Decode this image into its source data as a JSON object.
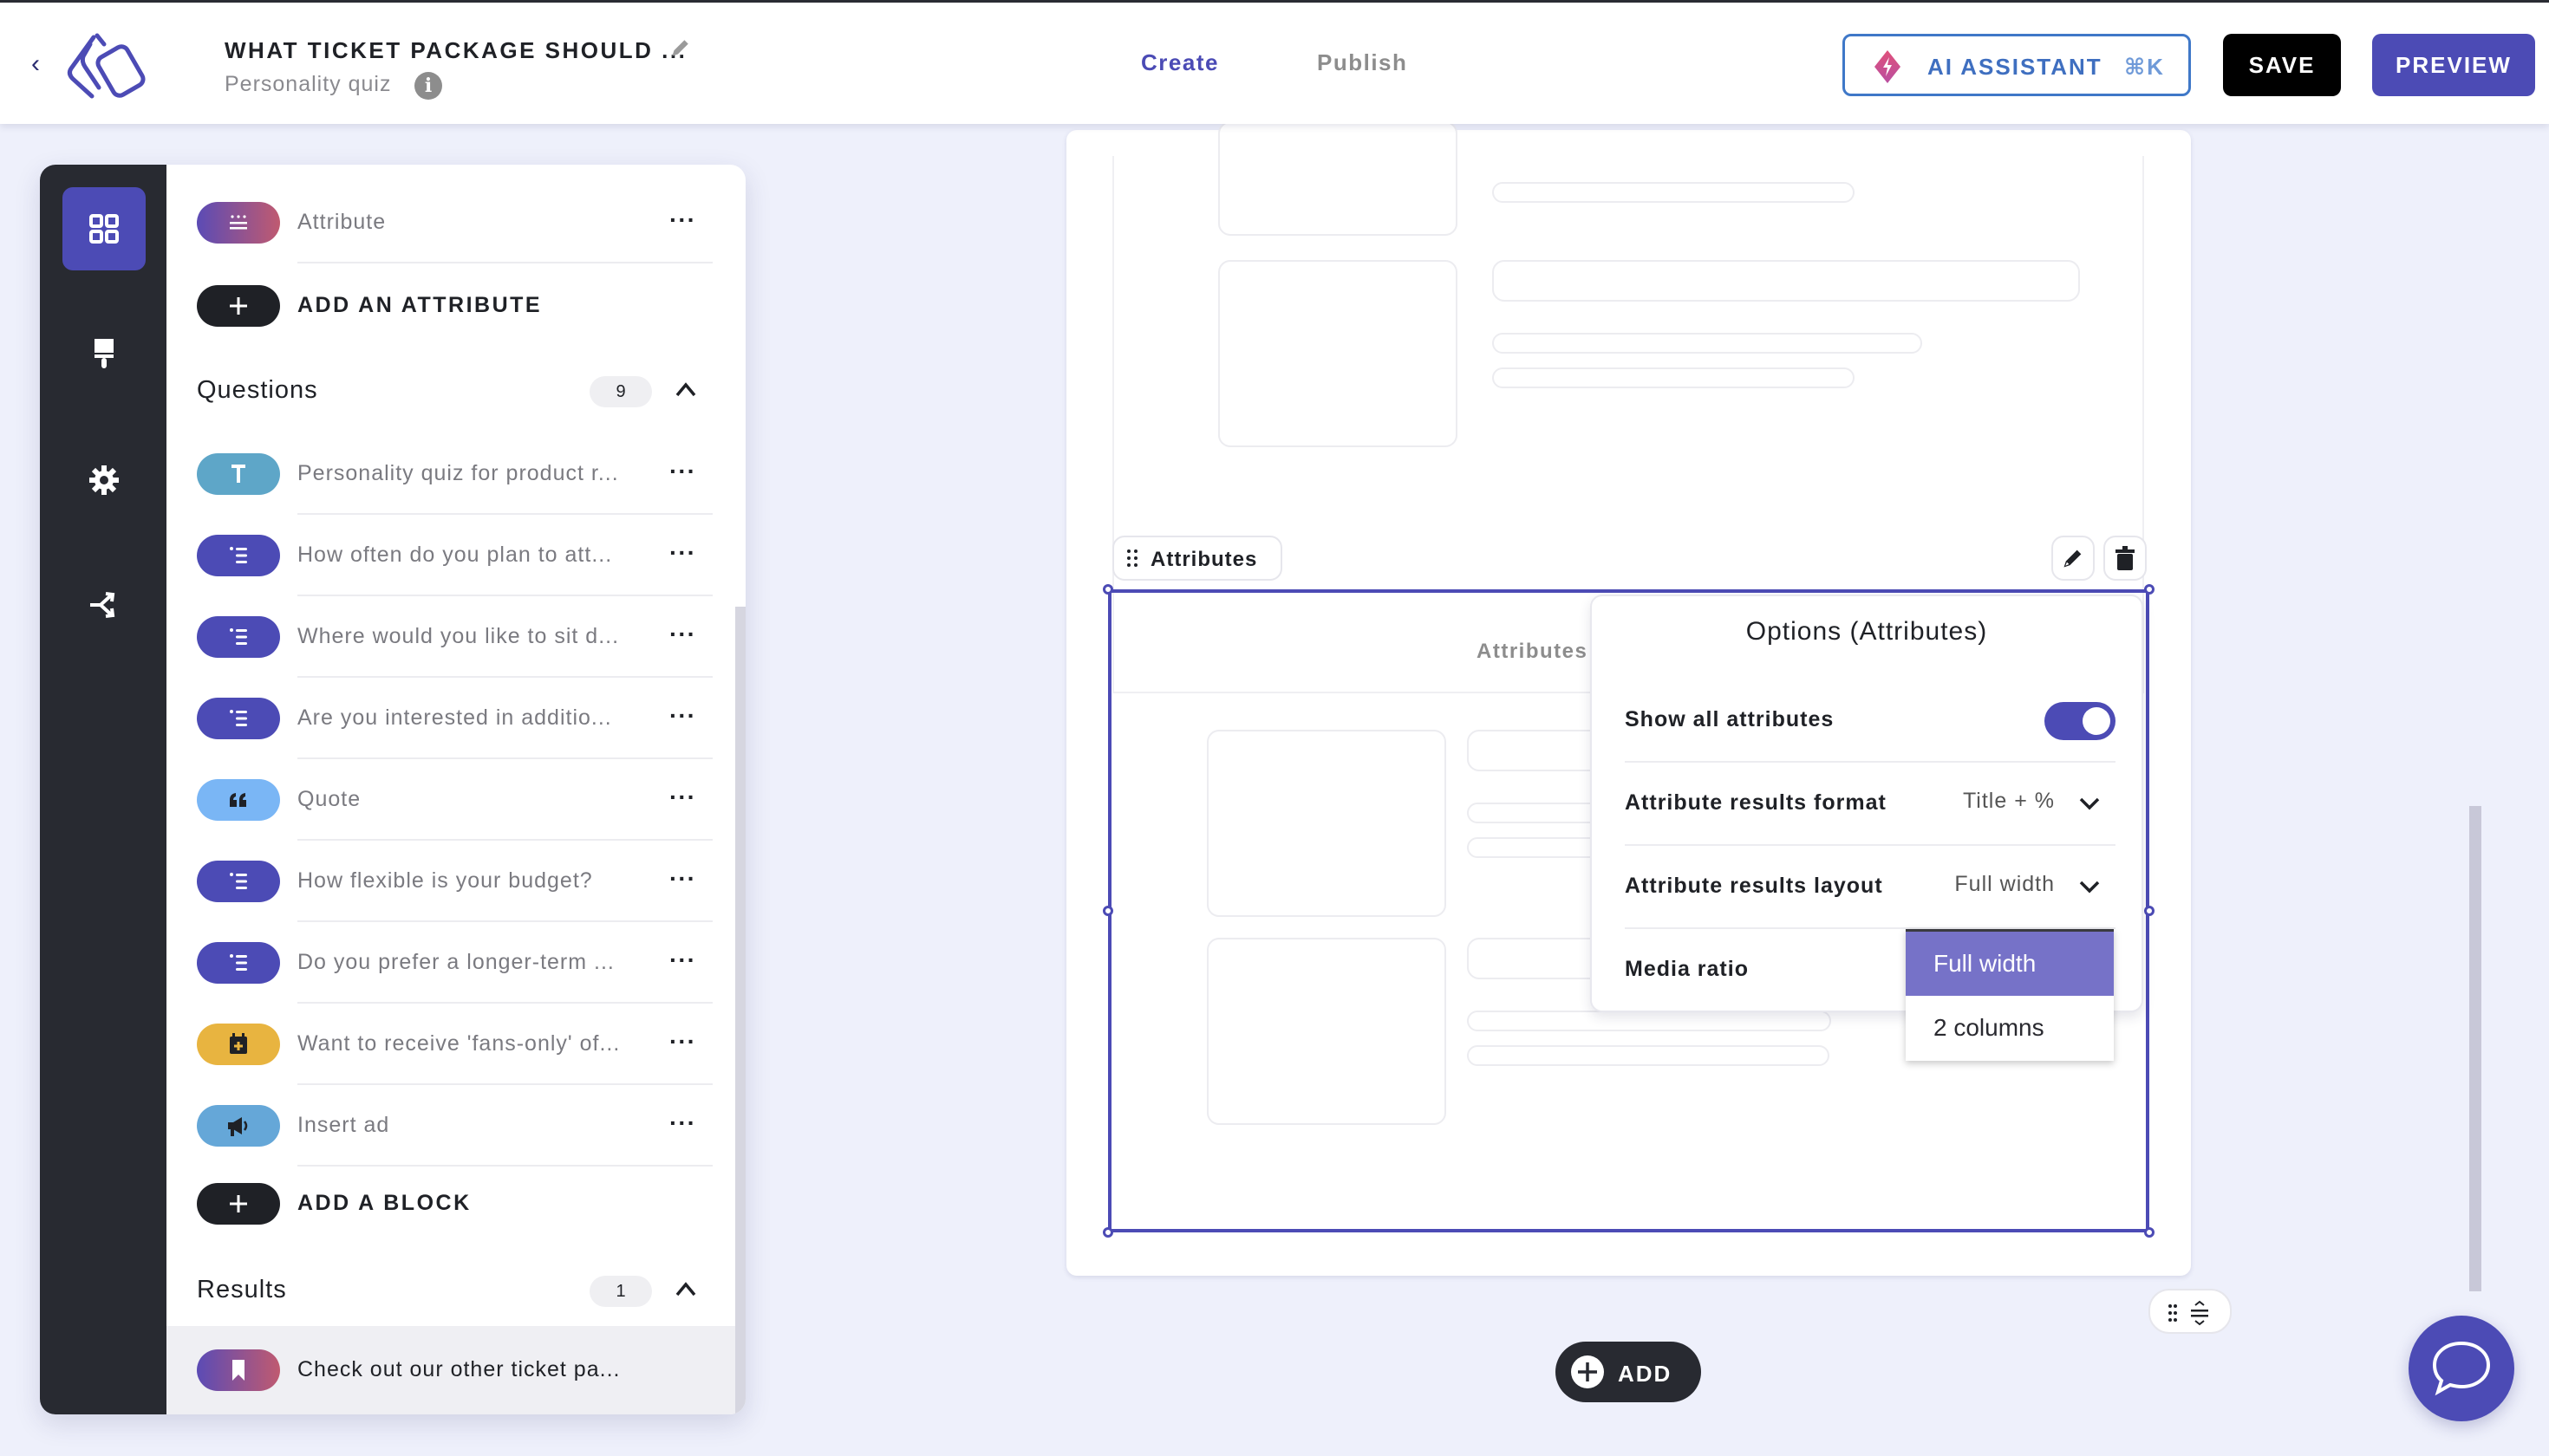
{
  "header": {
    "back_icon": "chevron-left-icon",
    "logo": "brand-logo",
    "title": "WHAT TICKET PACKAGE SHOULD ...",
    "subtitle": "Personality quiz",
    "tabs": [
      {
        "label": "Create",
        "active": true
      },
      {
        "label": "Publish",
        "active": false
      }
    ],
    "ai_assistant": {
      "label": "AI ASSISTANT",
      "shortcut": "⌘K"
    },
    "save_label": "SAVE",
    "preview_label": "PREVIEW"
  },
  "rail": {
    "items": [
      {
        "icon": "blocks-grid-icon",
        "active": true
      },
      {
        "icon": "paintbrush-icon",
        "active": false
      },
      {
        "icon": "gear-icon",
        "active": false
      },
      {
        "icon": "branching-logic-icon",
        "active": false
      }
    ]
  },
  "panel": {
    "attribute_item": {
      "label": "Attribute",
      "icon": "attribute-list-icon"
    },
    "add_attribute_label": "ADD AN ATTRIBUTE",
    "questions": {
      "title": "Questions",
      "count": "9",
      "items": [
        {
          "label": "Personality quiz for product r...",
          "icon": "text-T-icon",
          "color": "#5ea6c8"
        },
        {
          "label": "How often do you plan to att...",
          "icon": "list-icon",
          "color": "#4c4bb5"
        },
        {
          "label": "Where would you like to sit d...",
          "icon": "list-icon",
          "color": "#4c4bb5"
        },
        {
          "label": "Are you interested in additio...",
          "icon": "list-icon",
          "color": "#4c4bb5"
        },
        {
          "label": "Quote",
          "icon": "quote-icon",
          "color": "#7ab6f5"
        },
        {
          "label": "How flexible is your budget?",
          "icon": "list-icon",
          "color": "#4c4bb5"
        },
        {
          "label": "Do you prefer a longer-term ...",
          "icon": "list-icon",
          "color": "#4c4bb5"
        },
        {
          "label": "Want to receive 'fans-only' of...",
          "icon": "calendar-plus-icon",
          "color": "#e8b440"
        },
        {
          "label": "Insert ad",
          "icon": "megaphone-icon",
          "color": "#65a7d8"
        }
      ]
    },
    "add_block_label": "ADD A BLOCK",
    "results": {
      "title": "Results",
      "count": "1",
      "items": [
        {
          "label": "Check out our other ticket pa...",
          "icon": "bookmark-icon"
        }
      ]
    },
    "more_icon": "more-horizontal-icon"
  },
  "canvas": {
    "block_tag": "Attributes",
    "block_heading": "Attributes",
    "options": {
      "title": "Options (Attributes)",
      "rows": [
        {
          "label": "Show all attributes",
          "type": "toggle",
          "value": true
        },
        {
          "label": "Attribute results format",
          "type": "select",
          "value": "Title + %"
        },
        {
          "label": "Attribute results layout",
          "type": "select",
          "value": "Full width"
        },
        {
          "label": "Media ratio",
          "type": "select",
          "value": ""
        }
      ],
      "dropdown_options": [
        {
          "label": "Full width",
          "selected": true
        },
        {
          "label": "2 columns",
          "selected": false
        }
      ]
    },
    "add_label": "ADD"
  },
  "colors": {
    "accent": "#4c4bb5",
    "rail_bg": "#282a31",
    "page_bg": "#eef0fb",
    "ai_border": "#3f78c8",
    "dropdown_selected": "#7672c8"
  }
}
